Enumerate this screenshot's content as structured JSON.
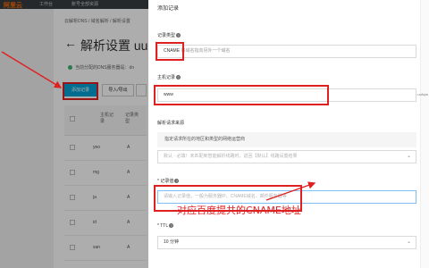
{
  "app": {
    "logo": "阿里云"
  },
  "topbar": {
    "nav": [
      "工作台",
      "账号全部资源"
    ]
  },
  "console": {
    "breadcrumb": "云解析DNS / 域名解析 / 解析设置",
    "page_title": "解析设置 uu",
    "dns_tip": "当前分配的DNS服务器是：dn",
    "buttons": {
      "add_record": "添加记录",
      "import_export": "导入/导出"
    },
    "table": {
      "headers": [
        "主机记录",
        "记录类型"
      ],
      "rows": [
        {
          "host": "yeo",
          "type": "A"
        },
        {
          "host": "mg",
          "type": "A"
        },
        {
          "host": "ja",
          "type": "A"
        },
        {
          "host": "id",
          "type": "A"
        },
        {
          "host": "san",
          "type": "A"
        }
      ]
    }
  },
  "drawer": {
    "title": "添加记录",
    "record_type": {
      "label": "记录类型",
      "value": "CNAME",
      "hint": "将域名指向另外一个域名"
    },
    "host_record": {
      "label": "主机记录",
      "value": "www",
      "suffix": ".uuhyw"
    },
    "resolution_line": {
      "label": "解析请求来源",
      "note": "指定请求所在的地区和类型的网络运营商",
      "placeholder": "默认 - 必填！未匹配到智能解析线路时，返回【默认】线路设置结果"
    },
    "record_value": {
      "label": "* 记录值",
      "placeholder": "请输入记录值，一般为服务器IP、CNAME域名、邮件服务器等"
    },
    "ttl": {
      "label": "* TTL",
      "value": "10 分钟"
    }
  },
  "annotation": {
    "text": "对应百度提共的CNAME地址",
    "color": "#e02020"
  }
}
